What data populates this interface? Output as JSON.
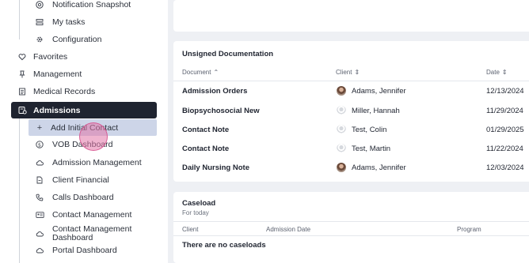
{
  "sidebar": {
    "items": [
      {
        "label": "Notification Snapshot",
        "icon": "bell-circle-icon"
      },
      {
        "label": "My tasks",
        "icon": "list-icon"
      },
      {
        "label": "Configuration",
        "icon": "gear-icon"
      },
      {
        "label": "Favorites",
        "icon": "heart-icon"
      },
      {
        "label": "Management",
        "icon": "pin-icon"
      },
      {
        "label": "Medical Records",
        "icon": "document-icon"
      },
      {
        "label": "Admissions",
        "icon": "admissions-icon"
      },
      {
        "label": "Add Initial Contact",
        "icon": "plus-icon"
      },
      {
        "label": "VOB Dashboard",
        "icon": "dollar-circle-icon"
      },
      {
        "label": "Admission Management",
        "icon": "cloud-icon"
      },
      {
        "label": "Client Financial",
        "icon": "file-icon"
      },
      {
        "label": "Calls Dashboard",
        "icon": "phone-icon"
      },
      {
        "label": "Contact Management",
        "icon": "id-card-icon"
      },
      {
        "label": "Contact Management Dashboard",
        "icon": "cloud-icon"
      },
      {
        "label": "Portal Dashboard",
        "icon": "cloud-icon"
      }
    ]
  },
  "unsigned": {
    "title": "Unsigned Documentation",
    "headers": {
      "document": "Document",
      "client": "Client",
      "date": "Date"
    },
    "rows": [
      {
        "document": "Admission Orders",
        "client": "Adams, Jennifer",
        "date": "12/13/2024",
        "avatar": "photo"
      },
      {
        "document": "Biopsychosocial New",
        "client": "Miller, Hannah",
        "date": "11/29/2024",
        "avatar": "blank"
      },
      {
        "document": "Contact Note",
        "client": "Test, Colin",
        "date": "01/29/2025",
        "avatar": "blank"
      },
      {
        "document": "Contact Note",
        "client": "Test, Martin",
        "date": "11/22/2024",
        "avatar": "blank"
      },
      {
        "document": "Daily Nursing Note",
        "client": "Adams, Jennifer",
        "date": "12/03/2024",
        "avatar": "photo"
      }
    ]
  },
  "caseload": {
    "title": "Caseload",
    "subtitle": "For today",
    "headers": {
      "client": "Client",
      "admission_date": "Admission Date",
      "program": "Program"
    },
    "empty": "There are no caseloads"
  },
  "colors": {
    "active_bg": "#1f2430",
    "hover_bg": "#cdd5e8",
    "page_bg": "#eef0f4"
  }
}
